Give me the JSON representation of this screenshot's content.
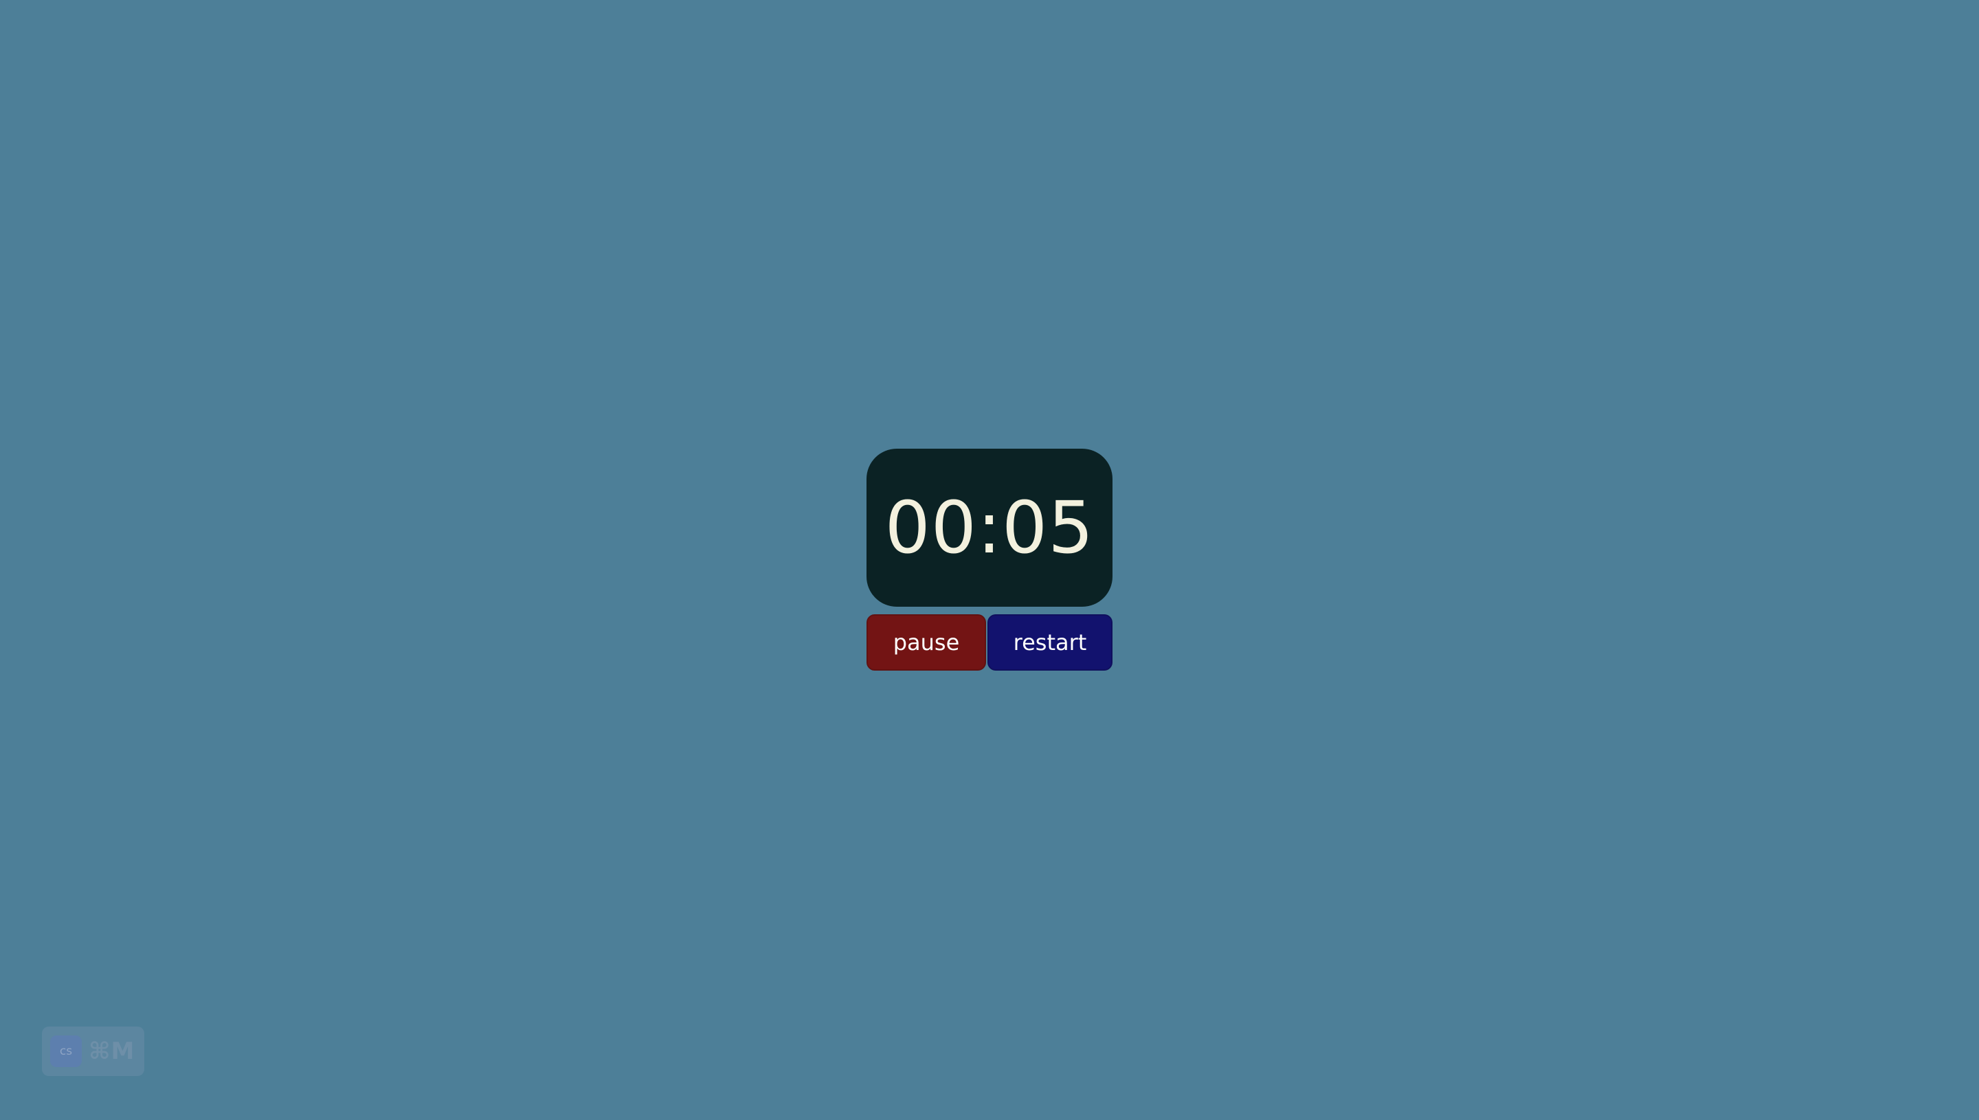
{
  "timer": {
    "display": "00:05"
  },
  "controls": {
    "pause_label": "pause",
    "restart_label": "restart"
  },
  "shortcut": {
    "logo_text": "cs",
    "keys": "⌘M"
  },
  "colors": {
    "background": "#4d7f98",
    "display_bg": "#0b2224",
    "display_text": "#f3f1de",
    "pause_bg": "#731414",
    "restart_bg": "#12126e"
  }
}
